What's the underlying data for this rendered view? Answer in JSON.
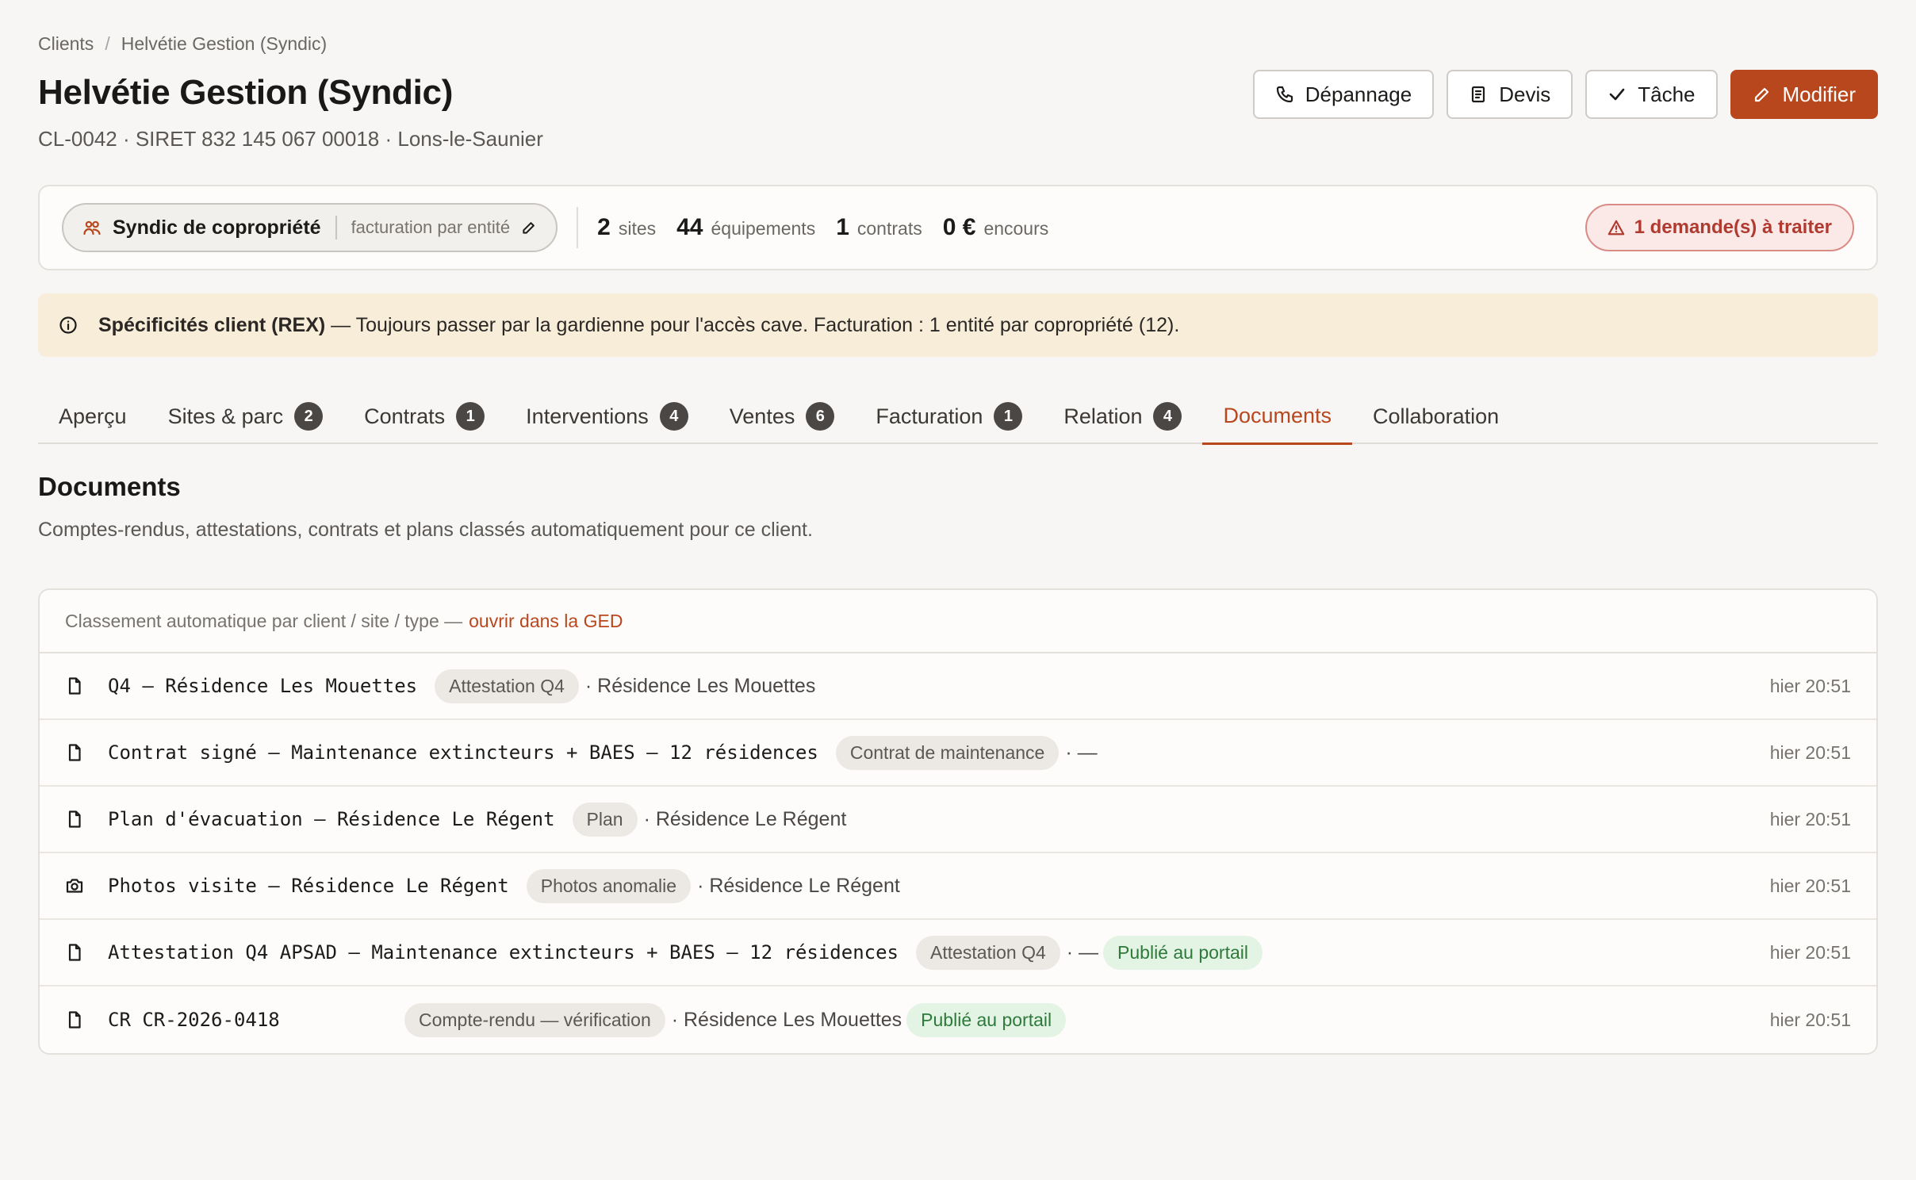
{
  "breadcrumb": {
    "root": "Clients",
    "separator": "/",
    "current": "Helvétie Gestion (Syndic)"
  },
  "header": {
    "title": "Helvétie Gestion (Syndic)",
    "subtitle": "CL-0042 · SIRET 832 145 067 00018 · Lons-le-Saunier",
    "buttons": {
      "depannage": "Dépannage",
      "devis": "Devis",
      "tache": "Tâche",
      "modifier": "Modifier"
    }
  },
  "stats": {
    "type_label": "Syndic de copropriété",
    "type_sub": "facturation par entité",
    "sites_num": "2",
    "sites_unit": "sites",
    "equip_num": "44",
    "equip_unit": "équipements",
    "contrats_num": "1",
    "contrats_unit": "contrats",
    "encours_num": "0 €",
    "encours_unit": "encours",
    "alert": "1 demande(s) à traiter"
  },
  "rex": {
    "title": "Spécificités client (REX)",
    "text": " — Toujours passer par la gardienne pour l'accès cave. Facturation : 1 entité par copropriété (12)."
  },
  "tabs": [
    {
      "label": "Aperçu",
      "badge": ""
    },
    {
      "label": "Sites & parc",
      "badge": "2"
    },
    {
      "label": "Contrats",
      "badge": "1"
    },
    {
      "label": "Interventions",
      "badge": "4"
    },
    {
      "label": "Ventes",
      "badge": "6"
    },
    {
      "label": "Facturation",
      "badge": "1"
    },
    {
      "label": "Relation",
      "badge": "4"
    },
    {
      "label": "Documents",
      "badge": ""
    },
    {
      "label": "Collaboration",
      "badge": ""
    }
  ],
  "section": {
    "title": "Documents",
    "description": "Comptes-rendus, attestations, contrats et plans classés automatiquement pour ce client."
  },
  "card": {
    "header_text": "Classement automatique par client / site / type —",
    "header_link": "ouvrir dans la GED"
  },
  "documents": [
    {
      "icon": "file-icon",
      "name": "Q4 — Résidence Les Mouettes",
      "tag": "Attestation Q4",
      "site": "· Résidence Les Mouettes",
      "published": "",
      "time": "hier 20:51"
    },
    {
      "icon": "file-icon",
      "name": "Contrat signé — Maintenance extincteurs + BAES — 12 résidences",
      "tag": "Contrat de maintenance",
      "site": "· —",
      "published": "",
      "time": "hier 20:51"
    },
    {
      "icon": "file-icon",
      "name": "Plan d'évacuation — Résidence Le Régent",
      "tag": "Plan",
      "site": "· Résidence Le Régent",
      "published": "",
      "time": "hier 20:51"
    },
    {
      "icon": "camera-icon",
      "name": "Photos visite — Résidence Le Régent",
      "tag": "Photos anomalie",
      "site": "· Résidence Le Régent",
      "published": "",
      "time": "hier 20:51"
    },
    {
      "icon": "file-icon",
      "name": "Attestation Q4 APSAD — Maintenance extincteurs + BAES — 12 résidences",
      "tag": "Attestation Q4",
      "site": "· —",
      "published": "Publié au portail",
      "time": "hier 20:51"
    },
    {
      "icon": "file-icon",
      "name": "CR CR-2026-0418",
      "tag": "Compte-rendu — vérification",
      "site": "· Résidence Les Mouettes",
      "published": "Publié au portail",
      "time": "hier 20:51"
    }
  ],
  "colors": {
    "accent": "#b9471d",
    "alert": "#b03a30",
    "banner": "#f7edd9",
    "published": "#2d7a3b"
  }
}
